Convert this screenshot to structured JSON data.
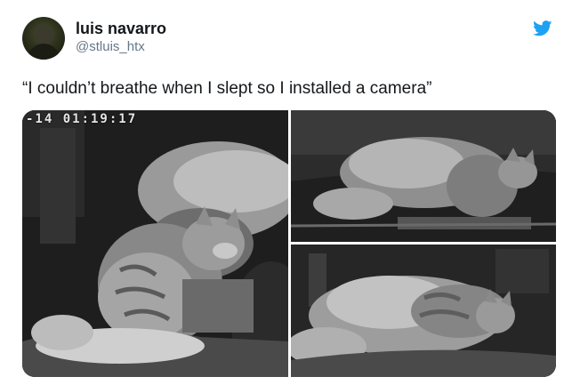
{
  "author": {
    "display_name": "luis navarro",
    "handle": "@stluis_htx"
  },
  "platform_icon": "twitter-bird-icon",
  "accent_color": "#1da1f2",
  "tweet": {
    "text": "“I couldn’t breathe when I slept so I installed a camera”"
  },
  "media": {
    "photo_count": 3,
    "photos": [
      {
        "timestamp": "-14  01:19:17"
      },
      {
        "timestamp": ""
      },
      {
        "timestamp": ""
      }
    ]
  }
}
